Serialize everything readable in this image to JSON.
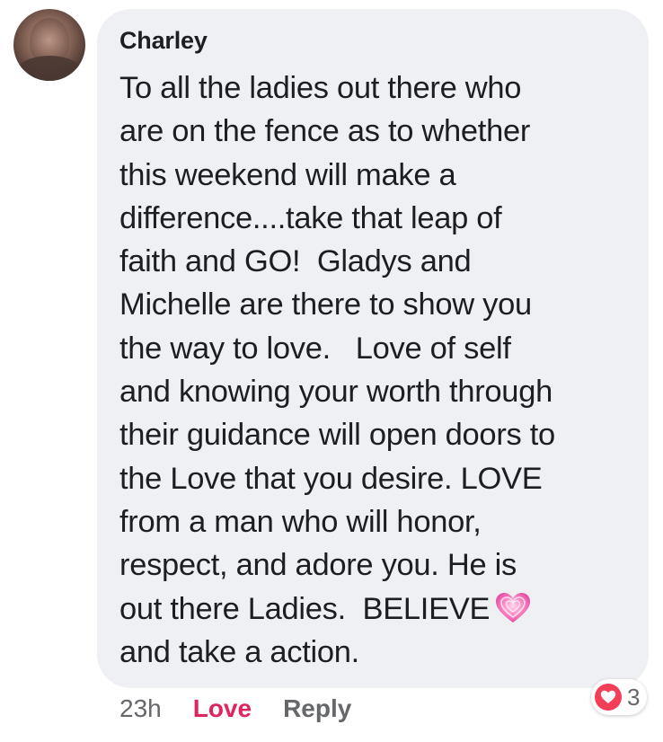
{
  "comment": {
    "author": "Charley",
    "lines": [
      "To all the ladies out there who",
      "are on the fence as to whether",
      "this weekend will make a",
      "difference....take that leap of",
      "faith and GO!  Gladys and",
      "Michelle are there to show you",
      "the way to love.   Love of self",
      "and knowing your worth through",
      "their guidance will open doors to",
      "the Love that you desire. LOVE",
      "from a man who will honor,",
      "respect, and adore you. He is",
      "out there Ladies.  BELIEVE",
      "and take a action."
    ],
    "emoji": "pink-heart-emoji"
  },
  "actions": {
    "time": "23h",
    "love_label": "Love",
    "reply_label": "Reply"
  },
  "reactions": {
    "type": "love",
    "count": "3",
    "color": "#f33e58"
  },
  "colors": {
    "bubble": "#eff0f4",
    "love_active": "#e0245e",
    "meta": "#65676b",
    "text": "#1c1e21"
  }
}
